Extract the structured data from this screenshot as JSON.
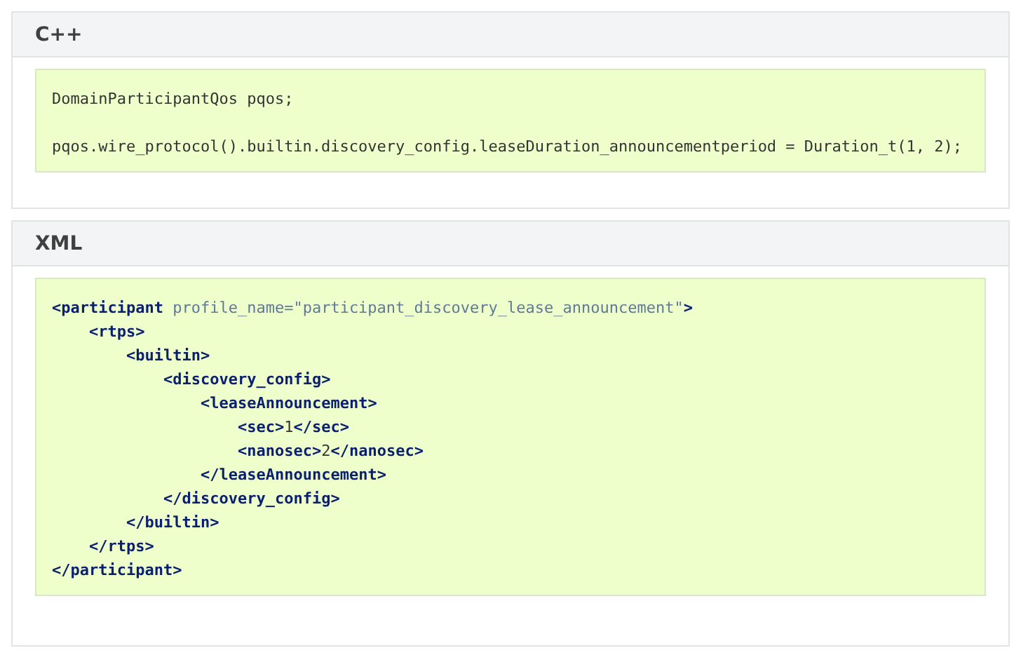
{
  "sections": [
    {
      "title": "C++",
      "lines": [
        {
          "segments": [
            {
              "kind": "text",
              "text": "DomainParticipantQos pqos;"
            }
          ]
        },
        {
          "kind": "blank"
        },
        {
          "segments": [
            {
              "kind": "text",
              "text": "pqos.wire_protocol().builtin.discovery_config.leaseDuration_announcementperiod = Duration_t(1, 2);"
            }
          ]
        }
      ]
    },
    {
      "title": "XML",
      "lines": [
        {
          "segments": [
            {
              "kind": "tag",
              "text": "<participant"
            },
            {
              "kind": "attr",
              "text": " profile_name="
            },
            {
              "kind": "value",
              "text": "\"participant_discovery_lease_announcement\""
            },
            {
              "kind": "tag",
              "text": ">"
            }
          ],
          "children": [
            {
              "segments": [
                {
                  "kind": "tag",
                  "text": "<rtps>"
                }
              ],
              "children": [
                {
                  "segments": [
                    {
                      "kind": "tag",
                      "text": "<builtin>"
                    }
                  ],
                  "children": [
                    {
                      "segments": [
                        {
                          "kind": "tag",
                          "text": "<discovery_config>"
                        }
                      ],
                      "children": [
                        {
                          "segments": [
                            {
                              "kind": "tag",
                              "text": "<leaseAnnouncement>"
                            }
                          ],
                          "children": [
                            {
                              "segments": [
                                {
                                  "kind": "tag",
                                  "text": "<sec>"
                                },
                                {
                                  "kind": "text",
                                  "text": "1"
                                },
                                {
                                  "kind": "tag",
                                  "text": "</sec>"
                                }
                              ]
                            },
                            {
                              "segments": [
                                {
                                  "kind": "tag",
                                  "text": "<nanosec>"
                                },
                                {
                                  "kind": "text",
                                  "text": "2"
                                },
                                {
                                  "kind": "tag",
                                  "text": "</nanosec>"
                                }
                              ]
                            }
                          ]
                        },
                        {
                          "segments": [
                            {
                              "kind": "tag",
                              "text": "</leaseAnnouncement>"
                            }
                          ]
                        }
                      ]
                    },
                    {
                      "segments": [
                        {
                          "kind": "tag",
                          "text": "</discovery_config>"
                        }
                      ]
                    }
                  ]
                },
                {
                  "segments": [
                    {
                      "kind": "tag",
                      "text": "</builtin>"
                    }
                  ]
                }
              ]
            },
            {
              "segments": [
                {
                  "kind": "tag",
                  "text": "</rtps>"
                }
              ]
            }
          ]
        },
        {
          "segments": [
            {
              "kind": "tag",
              "text": "</participant>"
            }
          ]
        }
      ]
    }
  ]
}
